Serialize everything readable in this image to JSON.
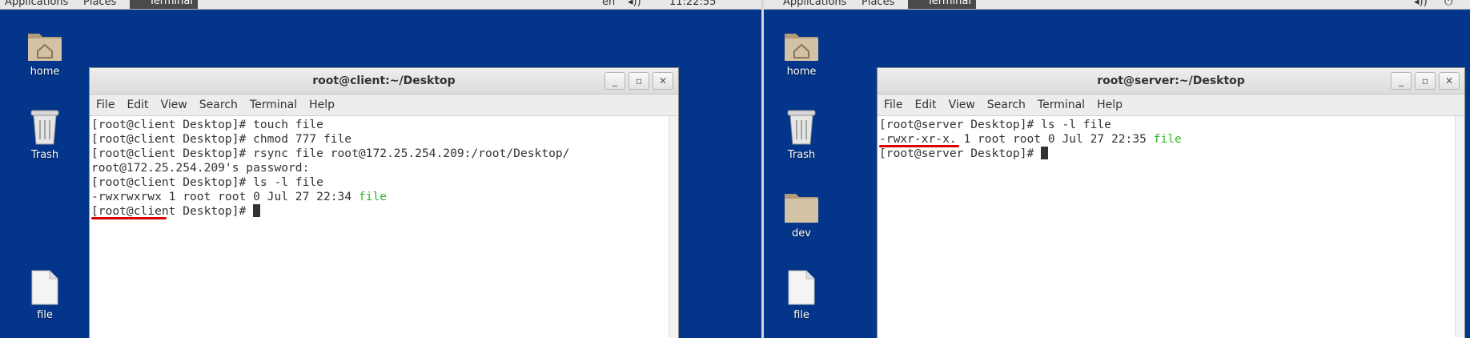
{
  "colors": {
    "desktop": "#03368a",
    "green": "#30b52a",
    "underline": "#d80000"
  },
  "left": {
    "topbar": {
      "applications": "Applications",
      "places": "Places",
      "terminal": "Terminal",
      "lang": "en",
      "clock": "11:22:55"
    },
    "icons": {
      "home": "home",
      "trash": "Trash",
      "file": "file"
    },
    "window": {
      "title": "root@client:~/Desktop",
      "menu": [
        "File",
        "Edit",
        "View",
        "Search",
        "Terminal",
        "Help"
      ],
      "lines": [
        "[root@client Desktop]# touch file",
        "[root@client Desktop]# chmod 777 file",
        "[root@client Desktop]# rsync file root@172.25.254.209:/root/Desktop/",
        "root@172.25.254.209's password:",
        "[root@client Desktop]# ls -l file"
      ],
      "ls_line": {
        "perm": "-rwxrwxrwx",
        "rest": " 1 root root 0 Jul 27 22:34 ",
        "name": "file"
      },
      "prompt": "[root@client Desktop]# "
    }
  },
  "right": {
    "topbar": {
      "applications": "Applications",
      "places": "Places",
      "terminal": "Terminal"
    },
    "icons": {
      "home": "home",
      "trash": "Trash",
      "dev": "dev",
      "file": "file"
    },
    "window": {
      "title": "root@server:~/Desktop",
      "menu": [
        "File",
        "Edit",
        "View",
        "Search",
        "Terminal",
        "Help"
      ],
      "lines": [
        "[root@server Desktop]# ls -l file"
      ],
      "ls_line": {
        "perm": "-rwxr-xr-x.",
        "rest": " 1 root root 0 Jul 27 22:35 ",
        "name": "file"
      },
      "prompt": "[root@server Desktop]# "
    }
  }
}
